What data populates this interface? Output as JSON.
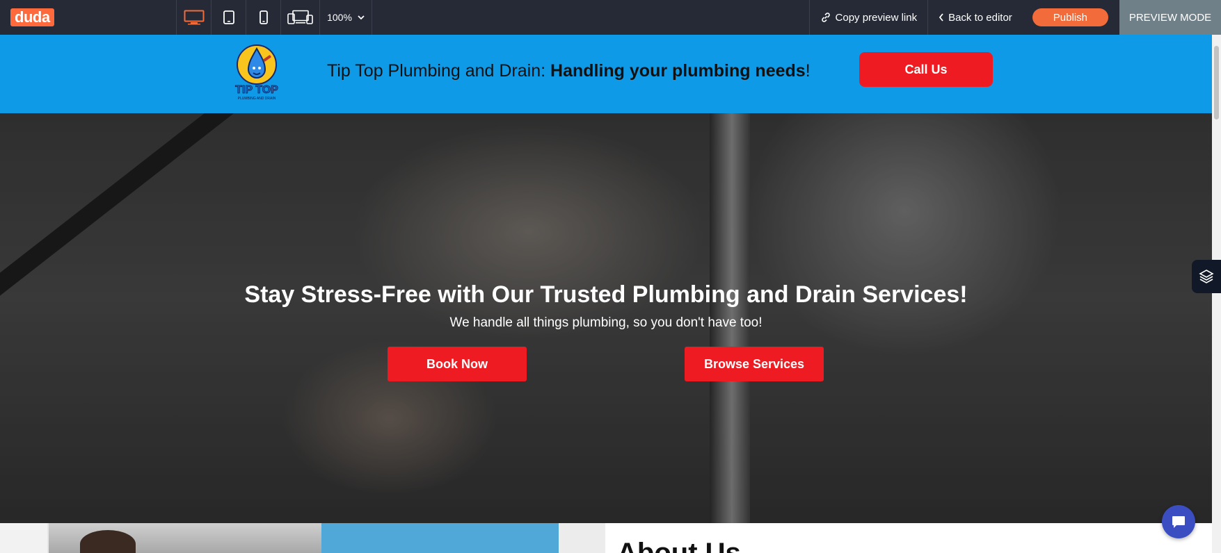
{
  "topbar": {
    "logo": "duda",
    "devices": [
      {
        "name": "desktop",
        "active": true
      },
      {
        "name": "tablet",
        "active": false
      },
      {
        "name": "mobile",
        "active": false
      },
      {
        "name": "responsive",
        "active": false
      }
    ],
    "zoom": "100%",
    "copy_preview_link": "Copy preview link",
    "back_to_editor": "Back to editor",
    "publish": "Publish",
    "preview_mode": "PREVIEW MODE",
    "accent_color": "#f26b3a",
    "active_device_color": "#f26b3a"
  },
  "header": {
    "tagline_regular": "Tip Top Plumbing and Drain: ",
    "tagline_bold": "Handling your plumbing needs",
    "tagline_end": "!",
    "call_button": "Call Us",
    "background_color": "#0f9ae8",
    "button_color": "#ee1c22",
    "logo_text": "TIP TOP",
    "logo_subtext": "PLUMBING AND DRAIN"
  },
  "hero": {
    "title": "Stay Stress-Free with Our Trusted Plumbing and Drain Services!",
    "subtitle": "We handle all things plumbing, so you don't have too!",
    "book_button": "Book Now",
    "browse_button": "Browse Services"
  },
  "about": {
    "title": "About Us"
  },
  "icons": {
    "desktop": "desktop-icon",
    "tablet": "tablet-icon",
    "mobile": "mobile-icon",
    "responsive": "responsive-icon",
    "link": "link-icon",
    "back": "chevron-left-icon",
    "zoom_dropdown": "chevron-down-icon",
    "side_widget": "layers-icon",
    "chat": "chat-icon"
  }
}
